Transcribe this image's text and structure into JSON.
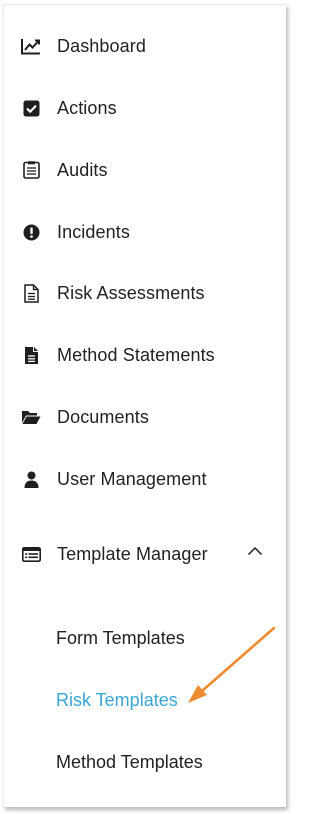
{
  "nav": {
    "items": [
      {
        "label": "Dashboard",
        "icon": "line-chart-icon"
      },
      {
        "label": "Actions",
        "icon": "check-square-icon"
      },
      {
        "label": "Audits",
        "icon": "clipboard-icon"
      },
      {
        "label": "Incidents",
        "icon": "exclamation-circle-icon"
      },
      {
        "label": "Risk Assessments",
        "icon": "document-outline-icon"
      },
      {
        "label": "Method Statements",
        "icon": "document-filled-icon"
      },
      {
        "label": "Documents",
        "icon": "folder-open-icon"
      },
      {
        "label": "User Management",
        "icon": "user-icon"
      },
      {
        "label": "Template Manager",
        "icon": "list-card-icon",
        "expanded": true
      }
    ],
    "submenu": [
      {
        "label": "Form Templates",
        "active": false
      },
      {
        "label": "Risk Templates",
        "active": true
      },
      {
        "label": "Method Templates",
        "active": false
      }
    ]
  },
  "colors": {
    "text": "#222222",
    "active_link": "#3aa6d6",
    "annotation_arrow": "#f08a2e"
  }
}
